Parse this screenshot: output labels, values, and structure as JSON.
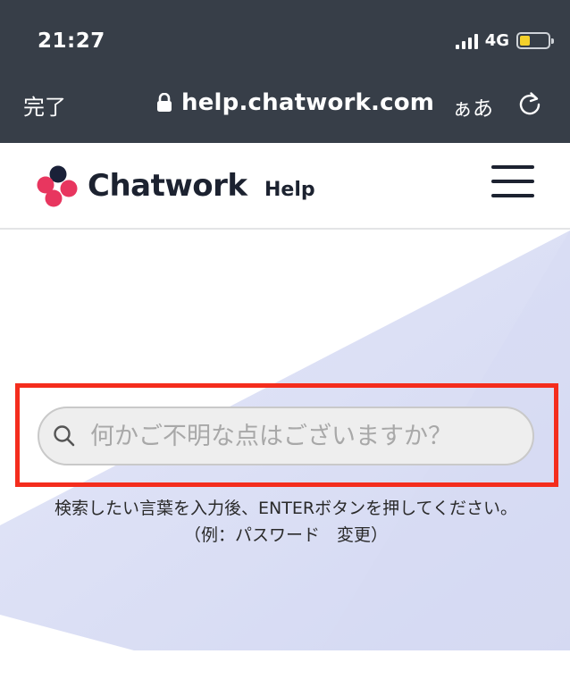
{
  "status_bar": {
    "time": "21:27",
    "network": "4G",
    "battery_level": 0.35,
    "battery_color": "#f4d12b"
  },
  "browser_bar": {
    "done_label": "完了",
    "url": "help.chatwork.com",
    "text_size_label": "ぁあ"
  },
  "header": {
    "brand": "Chatwork",
    "help_label": "Help",
    "logo_colors": [
      "#e8365f",
      "#1a2138"
    ]
  },
  "search": {
    "placeholder": "何かご不明な点はございますか？",
    "hint": "検索したい言葉を入力後、ENTERボタンを押してください。",
    "example": "（例：パスワード　変更）"
  },
  "colors": {
    "chrome": "#373e48",
    "highlight": "#f42d1d",
    "hero_tint": "#dde1f6"
  }
}
